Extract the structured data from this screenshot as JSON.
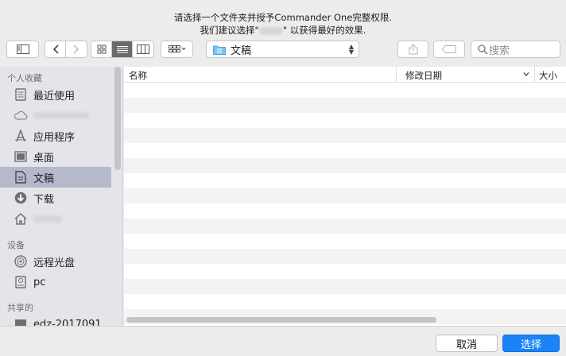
{
  "message": {
    "line1": "请选择一个文件夹并授予Commander One完整权限.",
    "line2_prefix": "我们建议选择\"",
    "line2_suffix": "\" 以获得最好的效果."
  },
  "toolbar": {
    "location": "文稿",
    "search_placeholder": "搜索"
  },
  "sidebar": {
    "favorites_title": "个人收藏",
    "favorites": [
      "最近使用",
      "",
      "应用程序",
      "桌面",
      "文稿",
      "下载",
      ""
    ],
    "devices_title": "设备",
    "devices": [
      "远程光盘",
      "pc"
    ],
    "shared_title": "共享的",
    "shared": [
      "edz-2017091"
    ]
  },
  "columns": [
    "名称",
    "修改日期",
    "大小"
  ],
  "footer": {
    "cancel": "取消",
    "choose": "选择"
  }
}
